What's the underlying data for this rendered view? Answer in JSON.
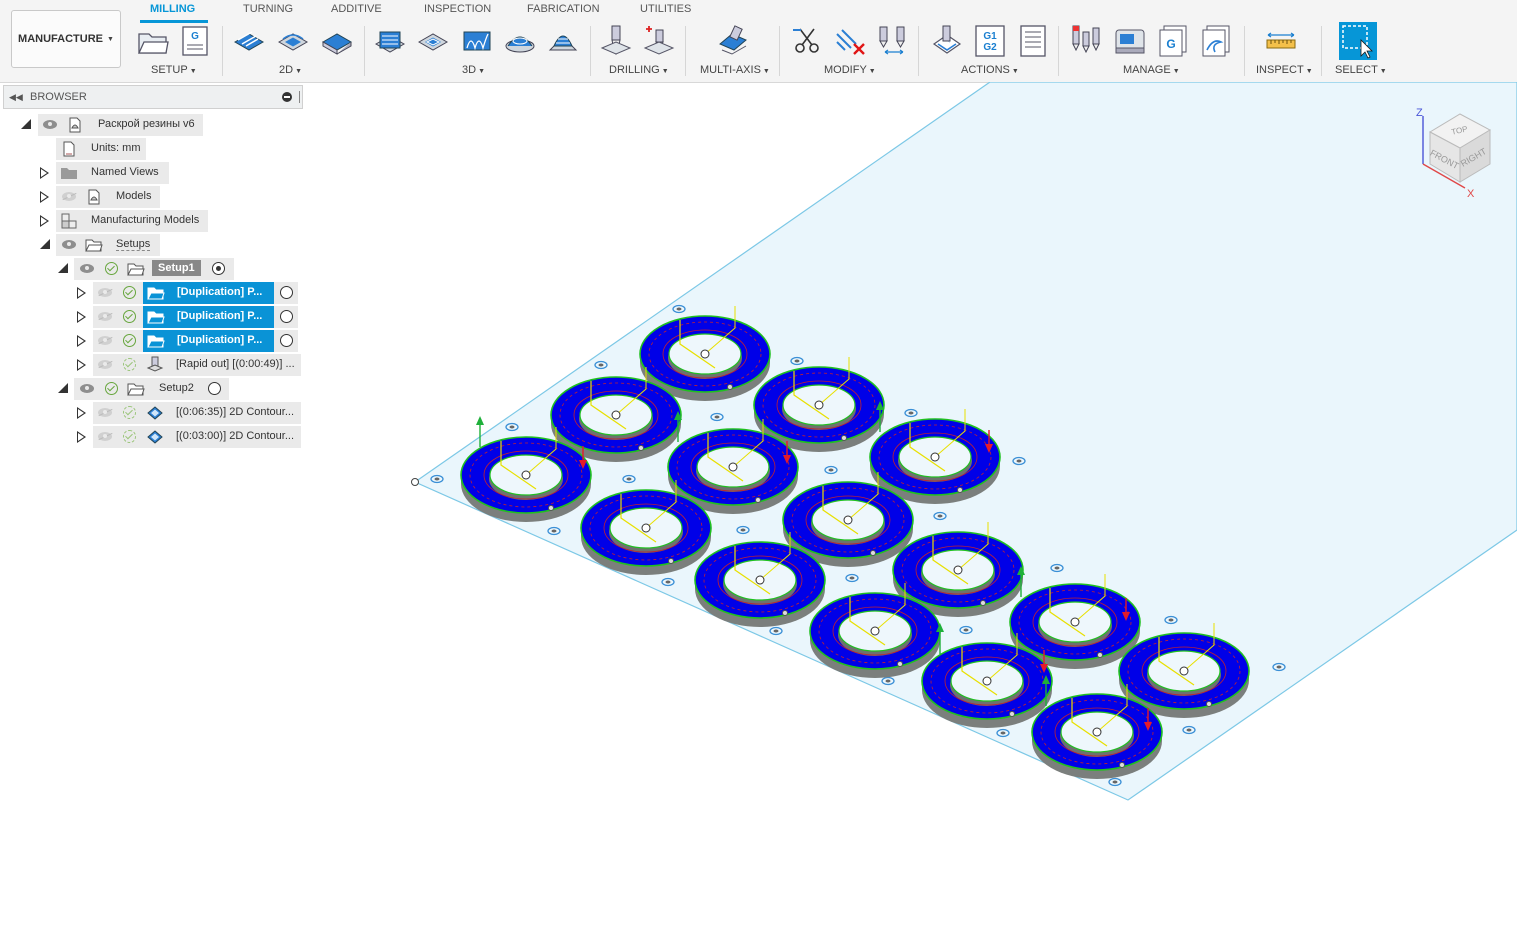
{
  "workspace": {
    "label": "MANUFACTURE"
  },
  "tabs": [
    "MILLING",
    "TURNING",
    "ADDITIVE",
    "INSPECTION",
    "FABRICATION",
    "UTILITIES"
  ],
  "groups": {
    "setup": "SETUP",
    "g2d": "2D",
    "g3d": "3D",
    "drilling": "DRILLING",
    "multiaxis": "MULTI-AXIS",
    "modify": "MODIFY",
    "actions": "ACTIONS",
    "manage": "MANAGE",
    "inspect": "INSPECT",
    "select": "SELECT"
  },
  "icon_text": {
    "g_letter": "G",
    "g1": "G1",
    "g2": "G2"
  },
  "browser": {
    "title": "BROWSER",
    "document": "Раскрой резины v6",
    "units": "Units: mm",
    "named_views": "Named Views",
    "models": "Models",
    "manufacturing_models": "Manufacturing Models",
    "setups": "Setups",
    "setup1": {
      "label": "Setup1",
      "ops": [
        "[Duplication] P...",
        "[Duplication] P...",
        "[Duplication] P...",
        "[Rapid out] [(0:00:49)] ..."
      ]
    },
    "setup2": {
      "label": "Setup2",
      "ops": [
        "[(0:06:35)] 2D Contour...",
        "[(0:03:00)] 2D Contour..."
      ]
    }
  },
  "viewcube": {
    "top": "TOP",
    "front": "FRONT",
    "right": "RIGHT",
    "axis_z": "Z",
    "axis_x": "X"
  },
  "colors": {
    "accent": "#0696d7",
    "part_fill": "#0000e8",
    "stock": "#eaf6fc",
    "stock_edge": "#7cc8e6",
    "toolpath": "#e8e000"
  }
}
